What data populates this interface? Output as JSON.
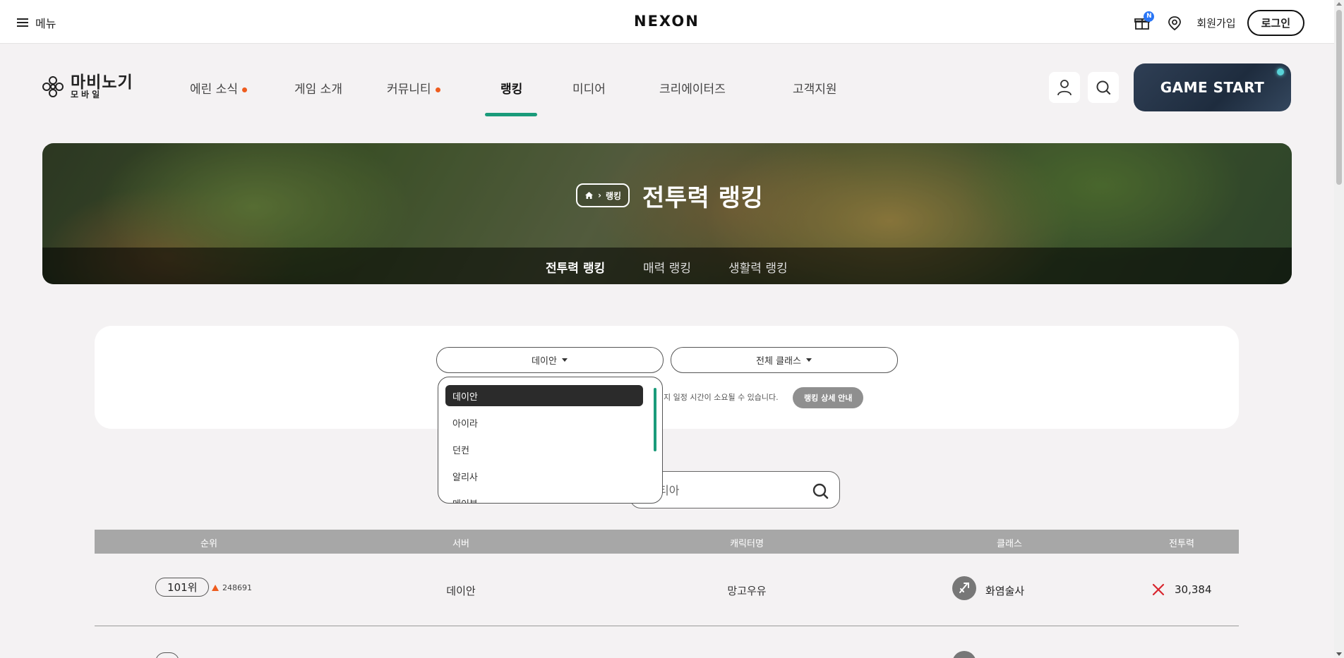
{
  "topbar": {
    "menu_label": "메뉴",
    "brand": "NEXON",
    "notification_badge": "N",
    "signup_label": "회원가입",
    "login_label": "로그인"
  },
  "game_nav": {
    "logo_main": "마비노기",
    "logo_sub": "모바일",
    "items": [
      {
        "label": "에린 소식",
        "has_dot": true
      },
      {
        "label": "게임 소개",
        "has_dot": false
      },
      {
        "label": "커뮤니티",
        "has_dot": true
      },
      {
        "label": "랭킹",
        "has_dot": false,
        "active": true
      },
      {
        "label": "미디어",
        "has_dot": false
      },
      {
        "label": "크리에이터즈",
        "has_dot": false
      },
      {
        "label": "고객지원",
        "has_dot": false
      }
    ],
    "game_start_label": "GAME START"
  },
  "banner": {
    "breadcrumb_label": "랭킹",
    "title": "전투력 랭킹",
    "tabs": [
      {
        "label": "전투력 랭킹",
        "active": true
      },
      {
        "label": "매력 랭킹",
        "active": false
      },
      {
        "label": "생활력 랭킹",
        "active": false
      }
    ]
  },
  "filters": {
    "server_select": "데이안",
    "class_select": "전체 클래스",
    "notice_text": "지 일정 시간이 소요될 수 있습니다.",
    "rank_guide_label": "랭킹 상세 안내"
  },
  "server_dropdown": {
    "options": [
      "데이안",
      "아이라",
      "던컨",
      "알리사",
      "메이븐"
    ],
    "selected": "데이안"
  },
  "search": {
    "value": "티아"
  },
  "table": {
    "headers": [
      "순위",
      "서버",
      "캐릭터명",
      "클래스",
      "전투력"
    ],
    "rows": [
      {
        "rank": "101위",
        "change": "248691",
        "server": "데이안",
        "character": "망고우유",
        "class": "화염술사",
        "power": "30,384"
      }
    ]
  },
  "colors": {
    "accent": "#1a9b7a",
    "new_dot": "#ee5c1e",
    "header_gray": "#a7a7a7"
  }
}
